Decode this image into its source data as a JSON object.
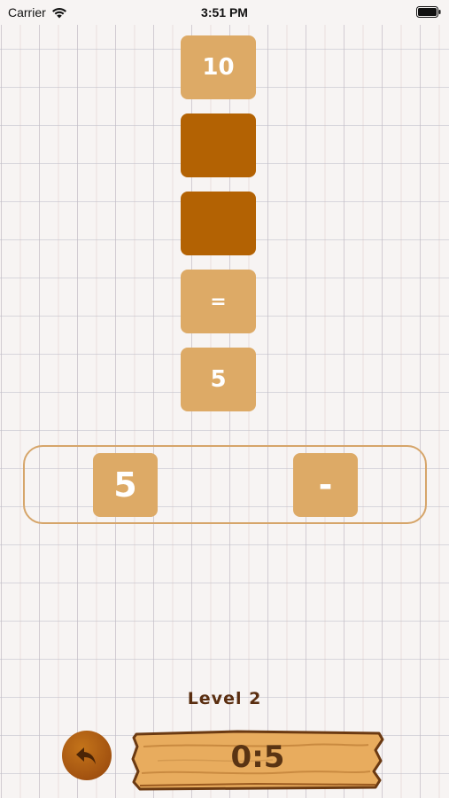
{
  "status_bar": {
    "carrier": "Carrier",
    "time": "3:51 PM"
  },
  "equation": {
    "tiles": [
      "10",
      "",
      "",
      "=",
      "5"
    ]
  },
  "options": {
    "tiles": [
      "5",
      "-"
    ]
  },
  "level_label": "Level 2",
  "timer": "0:5",
  "icons": {
    "wifi": "wifi-icon",
    "battery": "battery-icon",
    "back": "undo-arrow-icon"
  },
  "colors": {
    "tile_light": "#ddaa66",
    "tile_empty": "#b36203",
    "tray_border": "#d6a56a",
    "level_text": "#5a2e10",
    "wood": "#e8ac5e"
  }
}
